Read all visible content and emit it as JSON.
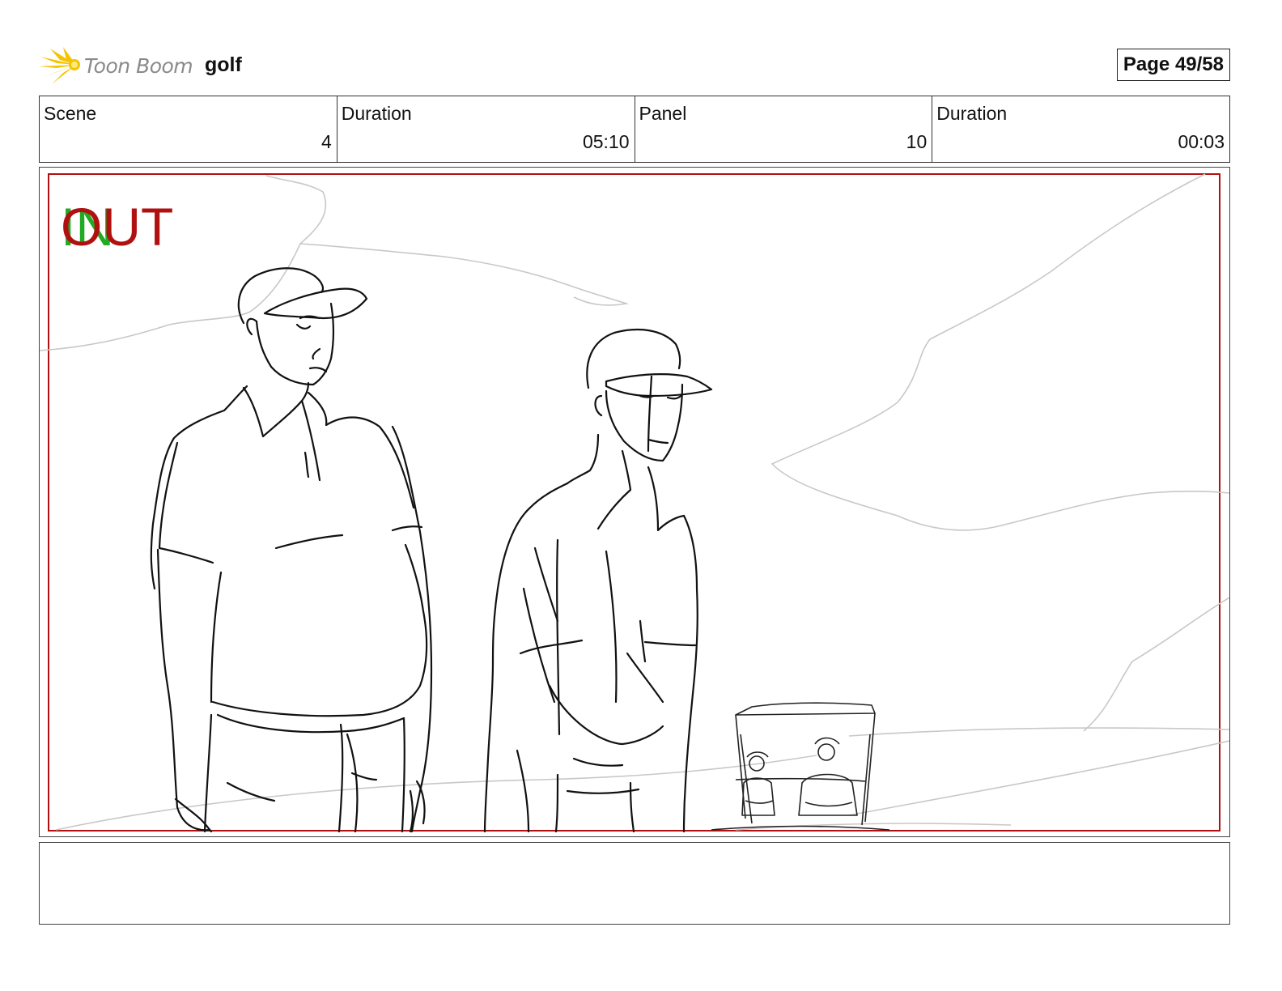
{
  "header": {
    "brand": "Toon Boom",
    "project_title": "golf",
    "page_label": "Page 49/58",
    "logo_icon": "starburst-logo-icon",
    "brand_color": "#f5c400"
  },
  "info": {
    "scene_label": "Scene",
    "scene_value": "4",
    "scene_duration_label": "Duration",
    "scene_duration_value": "05:10",
    "panel_label": "Panel",
    "panel_value": "10",
    "panel_duration_label": "Duration",
    "panel_duration_value": "00:03"
  },
  "panel": {
    "transition_in": "IN",
    "transition_out": "OUT",
    "in_color": "#22aa22",
    "out_color": "#b01010",
    "frame_color": "#b01010"
  },
  "notes": {
    "text": ""
  }
}
